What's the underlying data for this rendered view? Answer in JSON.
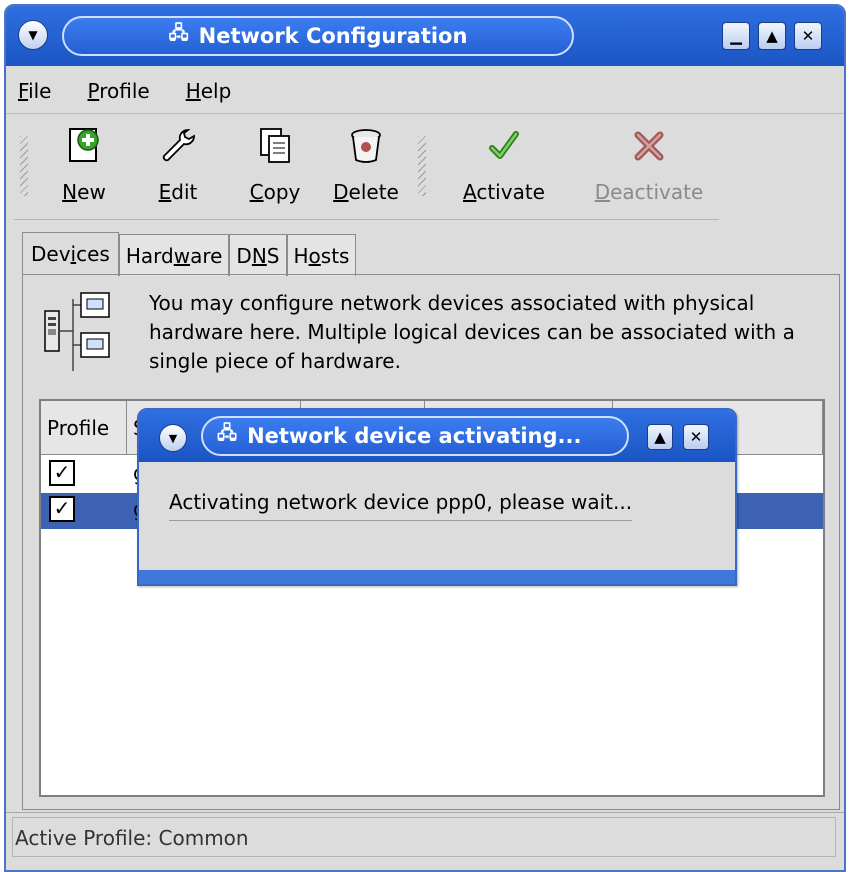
{
  "window": {
    "title": "Network Configuration",
    "title_icon": "network-icon",
    "controls": {
      "minimize": "▁",
      "maximize": "▲",
      "close": "✕"
    }
  },
  "menubar": {
    "items": [
      {
        "label": "File",
        "mnemonic": "F",
        "rest": "ile"
      },
      {
        "label": "Profile",
        "mnemonic": "P",
        "rest": "rofile"
      },
      {
        "label": "Help",
        "mnemonic": "H",
        "rest": "elp"
      }
    ]
  },
  "toolbar": {
    "buttons": [
      {
        "label": "New",
        "pre": "",
        "mnemonic": "N",
        "post": "ew",
        "icon": "new-icon",
        "glyph": "⊕",
        "enabled": true
      },
      {
        "label": "Edit",
        "pre": "",
        "mnemonic": "E",
        "post": "dit",
        "icon": "wrench-icon",
        "glyph": "🔧",
        "enabled": true
      },
      {
        "label": "Copy",
        "pre": "",
        "mnemonic": "C",
        "post": "opy",
        "icon": "copy-icon",
        "glyph": "⎘",
        "enabled": true
      },
      {
        "label": "Delete",
        "pre": "",
        "mnemonic": "D",
        "post": "elete",
        "icon": "trash-icon",
        "glyph": "🗑",
        "enabled": true
      },
      {
        "label": "Activate",
        "pre": "",
        "mnemonic": "A",
        "post": "ctivate",
        "icon": "checkmark-icon",
        "glyph": "✔",
        "enabled": true
      },
      {
        "label": "Deactivate",
        "pre": "",
        "mnemonic": "D",
        "post": "eactivate",
        "icon": "x-mark-icon",
        "glyph": "✖",
        "enabled": false
      }
    ]
  },
  "tabs": [
    {
      "pre": "Dev",
      "mnemonic": "i",
      "post": "ces",
      "active": true
    },
    {
      "pre": "Hard",
      "mnemonic": "w",
      "post": "are",
      "active": false
    },
    {
      "pre": "D",
      "mnemonic": "N",
      "post": "S",
      "active": false
    },
    {
      "pre": "H",
      "mnemonic": "o",
      "post": "sts",
      "active": false
    }
  ],
  "devices_panel": {
    "info": "You may configure network devices associated with physical hardware here.  Multiple logical devices can be associated with a single piece of hardware.",
    "columns": [
      "Profile",
      "S",
      "",
      "",
      ""
    ],
    "rows": [
      {
        "profile_checked": true,
        "text": "g",
        "selected": false
      },
      {
        "profile_checked": true,
        "text": "g",
        "selected": true
      }
    ]
  },
  "statusbar": {
    "text": "Active Profile: Common"
  },
  "dialog": {
    "title": "Network device activating...",
    "message": "Activating network device ppp0, please wait...",
    "controls": {
      "maximize": "▲",
      "close": "✕"
    }
  },
  "colors": {
    "titlebar": "#2f6fe0",
    "selection": "#3d62b3",
    "window_bg": "#dcdcdc",
    "check_green": "#3aa12b",
    "delete_red": "#b05050"
  }
}
